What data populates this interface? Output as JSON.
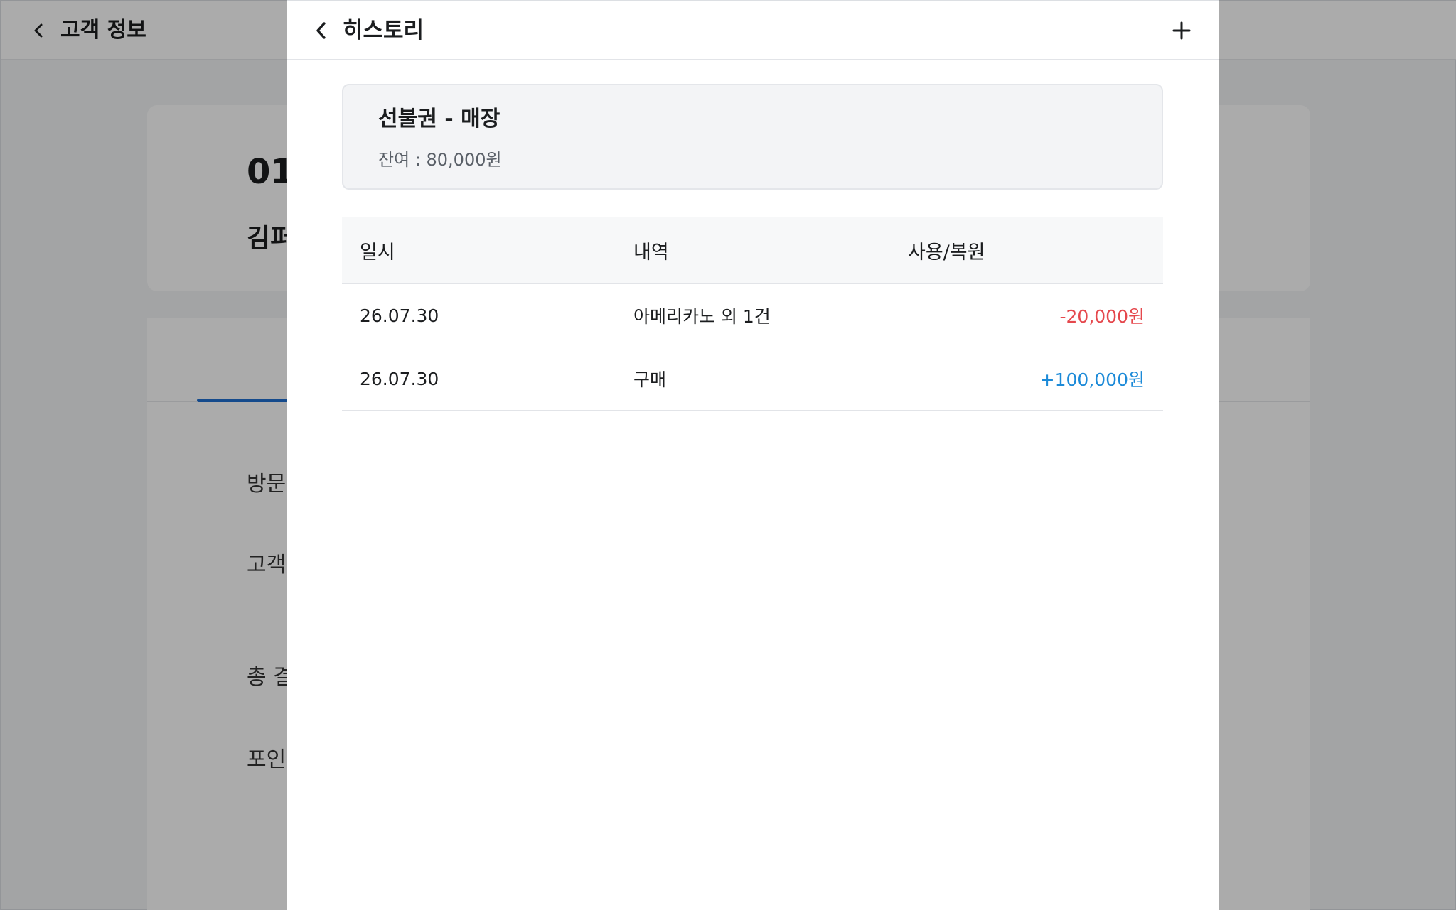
{
  "background": {
    "header": {
      "title": "고객 정보"
    },
    "customer": {
      "phone": "01",
      "name": "김퍼"
    },
    "rows": [
      "방문",
      "고객",
      "총 결",
      "포인"
    ]
  },
  "panel": {
    "title": "히스토리",
    "summary": {
      "title": "선불권 - 매장",
      "balance": "잔여 : 80,000원"
    },
    "table": {
      "headers": {
        "date": "일시",
        "description": "내역",
        "amount": "사용/복원"
      },
      "rows": [
        {
          "date": "26.07.30",
          "description": "아메리카노 외 1건",
          "amount": "-20,000원",
          "type": "use"
        },
        {
          "date": "26.07.30",
          "description": "구매",
          "amount": "+100,000원",
          "type": "restore"
        }
      ]
    }
  },
  "colors": {
    "use": "#e5484d",
    "restore": "#1c8ad8",
    "tab_active": "#1f6fd1"
  },
  "icons": {
    "back": "chevron-left-icon",
    "add": "plus-icon"
  }
}
